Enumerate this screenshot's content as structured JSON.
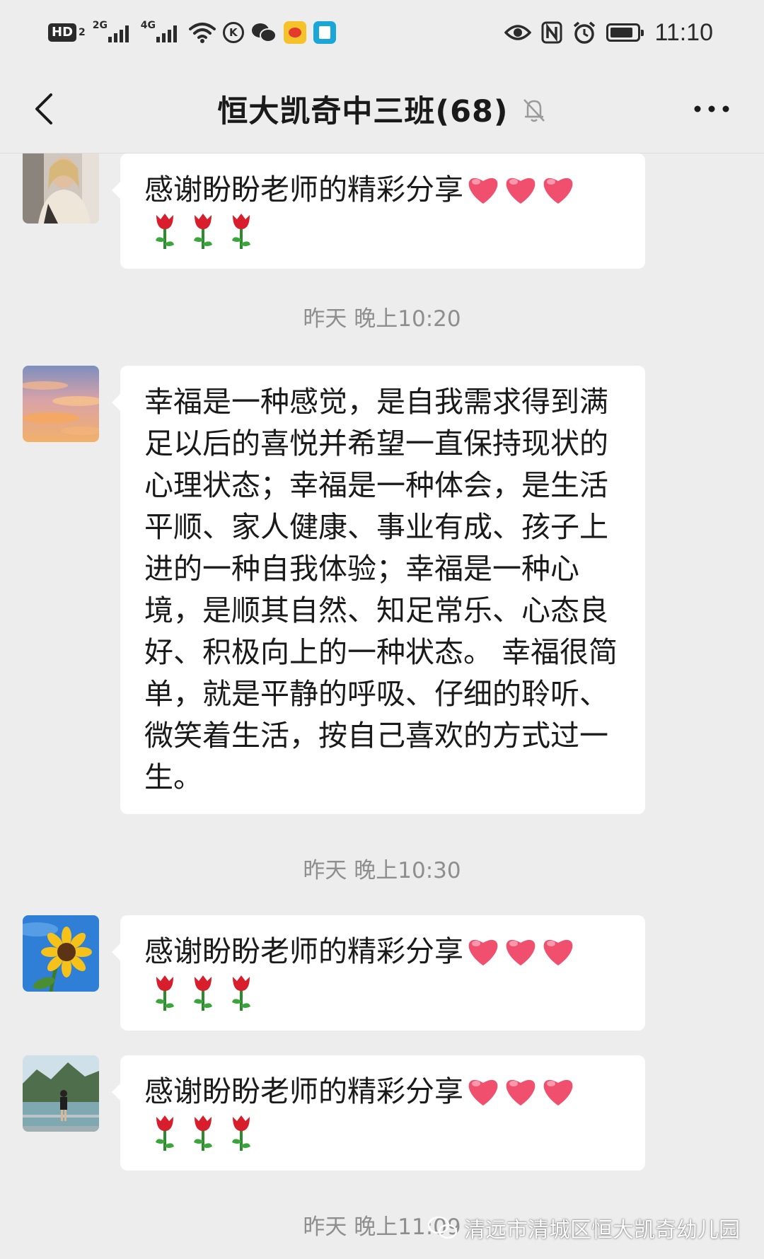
{
  "status_bar": {
    "hd_label": "HD",
    "hd_sub": "2",
    "net1": "2G",
    "net2": "4G",
    "k_icon_label": "K",
    "nfc_label": "N",
    "time": "11:10",
    "battery_level": 0.85
  },
  "header": {
    "title": "恒大凯奇中三班(68)",
    "muted": true
  },
  "messages": [
    {
      "text": "感谢盼盼老师的精彩分享",
      "hearts": 3,
      "roses": 3
    },
    {
      "text": "幸福是一种感觉，是自我需求得到满足以后的喜悦并希望一直保持现状的心理状态；幸福是一种体会，是生活平顺、家人健康、事业有成、孩子上进的一种自我体验；幸福是一种心境，是顺其自然、知足常乐、心态良好、积极向上的一种状态。 幸福很简单，就是平静的呼吸、仔细的聆听、微笑着生活，按自己喜欢的方式过一生。"
    },
    {
      "text": "感谢盼盼老师的精彩分享",
      "hearts": 3,
      "roses": 3
    },
    {
      "text": "感谢盼盼老师的精彩分享",
      "hearts": 3,
      "roses": 3
    }
  ],
  "timestamps": [
    "昨天 晚上10:20",
    "昨天 晚上10:30",
    "昨天 晚上11:09"
  ],
  "watermark": {
    "text": "清远市清城区恒大凯奇幼儿园"
  },
  "colors": {
    "background": "#ededed",
    "bubble": "#ffffff",
    "timestamp": "#8e8e8e",
    "heart": "#f0506e",
    "rose": "#d81e2c"
  },
  "icons": {
    "back": "chevron-left-icon",
    "mute": "bell-off-icon",
    "more": "more-dots-icon",
    "heart": "heart-icon",
    "rose": "rose-icon"
  }
}
